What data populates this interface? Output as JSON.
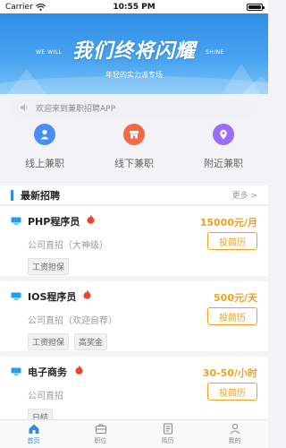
{
  "status_bar": {
    "carrier": "Carrier",
    "time": "10:55 PM"
  },
  "banner": {
    "title": "我们终将闪耀",
    "left_text": "WE WILL",
    "right_text": "SHINE",
    "subtitle": "年轻的实力派专场"
  },
  "notice": {
    "text": "欢迎来到兼职招聘APP",
    "icon": "speaker-icon"
  },
  "categories": [
    {
      "label": "线上兼职",
      "icon": "person-icon",
      "color": "#4a8ef5"
    },
    {
      "label": "线下兼职",
      "icon": "store-icon",
      "color": "#f46a44"
    },
    {
      "label": "附近兼职",
      "icon": "location-pin-icon",
      "color": "#9b6ef5"
    }
  ],
  "section": {
    "title": "最新招聘",
    "more": "更多 >"
  },
  "jobs": [
    {
      "title": "PHP程序员",
      "salary": "15000元/月",
      "company": "公司直招（大神级）",
      "apply": "投简历",
      "tags": [
        "工资担保"
      ]
    },
    {
      "title": "IOS程序员",
      "salary": "500元/天",
      "company": "公司直招（欢迎自荐）",
      "apply": "投简历",
      "tags": [
        "工资担保",
        "高奖金"
      ]
    },
    {
      "title": "电子商务",
      "salary": "30-50/小时",
      "company": "公司直招",
      "apply": "投简历",
      "tags": [
        "日结"
      ]
    }
  ],
  "tabbar": [
    {
      "label": "首页",
      "icon": "home-icon",
      "active": true
    },
    {
      "label": "职位",
      "icon": "briefcase-icon",
      "active": false
    },
    {
      "label": "简历",
      "icon": "resume-icon",
      "active": false
    },
    {
      "label": "我的",
      "icon": "user-icon",
      "active": false
    }
  ],
  "colors": {
    "accent": "#2f8de6",
    "salary": "#f0a020",
    "flame": "#e8452c"
  }
}
